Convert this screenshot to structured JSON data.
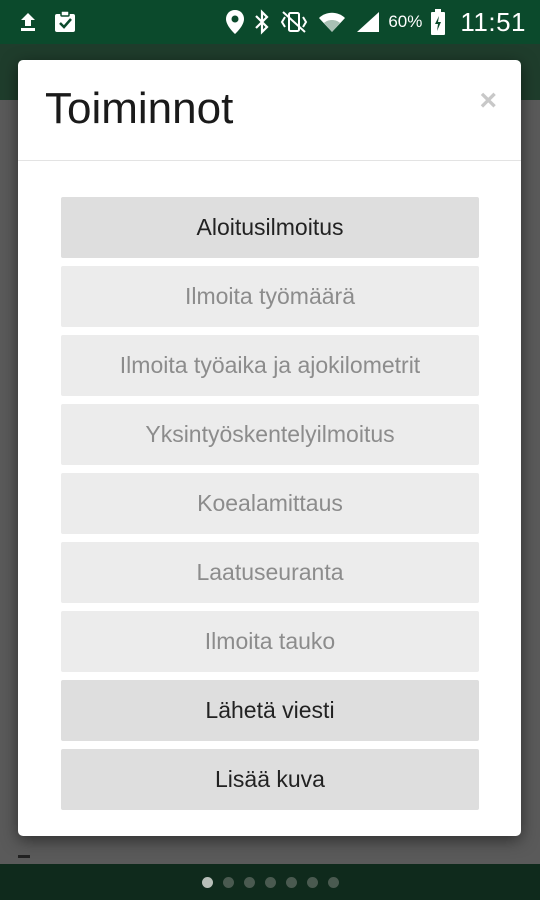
{
  "status_bar": {
    "battery_percent": "60%",
    "time": "11:51",
    "icons": [
      "upload-icon",
      "clipboard-check-icon",
      "location-icon",
      "bluetooth-icon",
      "vibrate-icon",
      "wifi-icon",
      "signal-icon",
      "battery-charging-icon"
    ]
  },
  "dialog": {
    "title": "Toiminnot",
    "close_label": "×",
    "actions": [
      {
        "label": "Aloitusilmoitus",
        "enabled": true
      },
      {
        "label": "Ilmoita työmäärä",
        "enabled": false
      },
      {
        "label": "Ilmoita työaika ja ajokilometrit",
        "enabled": false
      },
      {
        "label": "Yksintyöskentelyilmoitus",
        "enabled": false
      },
      {
        "label": "Koealamittaus",
        "enabled": false
      },
      {
        "label": "Laatuseuranta",
        "enabled": false
      },
      {
        "label": "Ilmoita tauko",
        "enabled": false
      },
      {
        "label": "Lähetä viesti",
        "enabled": true
      },
      {
        "label": "Lisää kuva",
        "enabled": true
      }
    ]
  },
  "pager": {
    "page_count": 7,
    "active_page": 1
  },
  "colors": {
    "status_bar": "#0b4a2c",
    "button_enabled": "#dedede",
    "button_disabled": "#ececec",
    "text_disabled": "#8c8c8c"
  }
}
